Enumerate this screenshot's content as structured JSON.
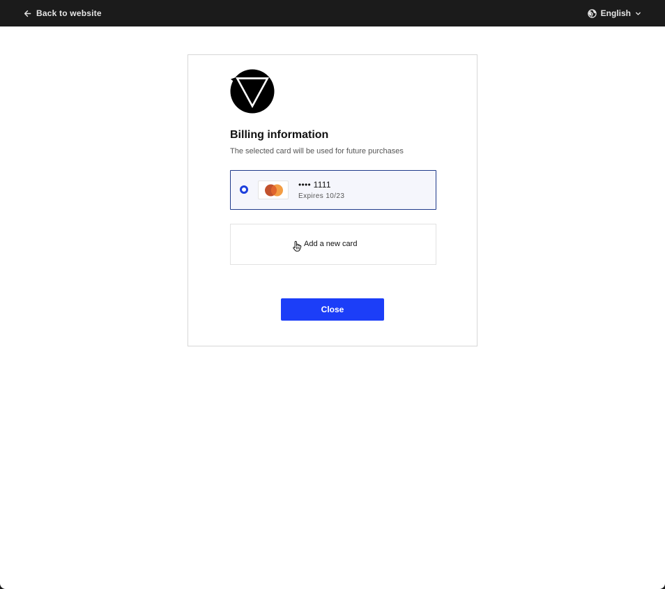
{
  "topbar": {
    "back_label": "Back to website",
    "back_icon": "arrow-left-icon",
    "language_label": "English",
    "language_icon": "globe-icon",
    "language_chevron_icon": "chevron-down-icon"
  },
  "billing": {
    "logo_icon": "brand-logo",
    "title": "Billing information",
    "subtitle": "The selected card will be used for future purchases",
    "saved_card": {
      "selected": true,
      "brand_icon": "mastercard-icon",
      "number": "•••• 1111",
      "expiry": "Expires 10/23"
    },
    "add_card_label": "Add a new card",
    "close_label": "Close"
  },
  "colors": {
    "topbar_bg": "#1b1b1b",
    "accent": "#1c3ef8",
    "selected_border": "#1f3a8a",
    "selected_bg": "#f5f6fc"
  }
}
